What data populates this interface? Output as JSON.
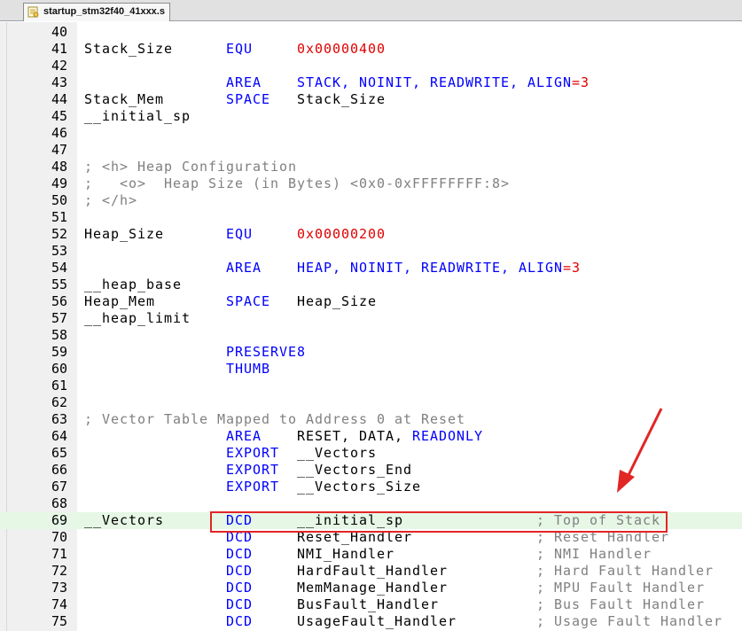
{
  "tab": {
    "filename": "startup_stm32f40_41xxx.s",
    "icon": "asm-file-icon"
  },
  "colors": {
    "keyword": "#0000ff",
    "number": "#e00000",
    "comment": "#808080",
    "highlight_row": "#e6f7e6",
    "annotation": "#e12626"
  },
  "annotation": {
    "box": "red-rectangle",
    "pointer": "red-arrow",
    "target_line": "69"
  },
  "lines": [
    {
      "n": "40",
      "tokens": []
    },
    {
      "n": "41",
      "tokens": [
        {
          "t": "Stack_Size",
          "k": "id",
          "c": 0
        },
        {
          "t": "EQU",
          "k": "kw",
          "c": 16
        },
        {
          "t": "0x00000400",
          "k": "num",
          "c": 24
        }
      ]
    },
    {
      "n": "42",
      "tokens": []
    },
    {
      "n": "43",
      "tokens": [
        {
          "t": "AREA",
          "k": "kw",
          "c": 16
        },
        {
          "t": "STACK,",
          "k": "kw",
          "c": 24
        },
        {
          "t": "NOINIT,",
          "k": "kw",
          "c": 31
        },
        {
          "t": "READWRITE,",
          "k": "kw",
          "c": 39
        },
        {
          "t": "ALIGN",
          "k": "kw",
          "c": 50
        },
        {
          "t": "=3",
          "k": "num",
          "c": 55
        }
      ]
    },
    {
      "n": "44",
      "tokens": [
        {
          "t": "Stack_Mem",
          "k": "id",
          "c": 0
        },
        {
          "t": "SPACE",
          "k": "kw",
          "c": 16
        },
        {
          "t": "Stack_Size",
          "k": "id",
          "c": 24
        }
      ]
    },
    {
      "n": "45",
      "tokens": [
        {
          "t": "__initial_sp",
          "k": "id",
          "c": 0
        }
      ]
    },
    {
      "n": "46",
      "tokens": []
    },
    {
      "n": "47",
      "tokens": []
    },
    {
      "n": "48",
      "tokens": [
        {
          "t": "; <h> Heap Configuration",
          "k": "cm",
          "c": 0
        }
      ]
    },
    {
      "n": "49",
      "tokens": [
        {
          "t": ";   <o>  Heap Size (in Bytes) <0x0-0xFFFFFFFF:8>",
          "k": "cm",
          "c": 0
        }
      ]
    },
    {
      "n": "50",
      "tokens": [
        {
          "t": "; </h>",
          "k": "cm",
          "c": 0
        }
      ]
    },
    {
      "n": "51",
      "tokens": []
    },
    {
      "n": "52",
      "tokens": [
        {
          "t": "Heap_Size",
          "k": "id",
          "c": 0
        },
        {
          "t": "EQU",
          "k": "kw",
          "c": 16
        },
        {
          "t": "0x00000200",
          "k": "num",
          "c": 24
        }
      ]
    },
    {
      "n": "53",
      "tokens": []
    },
    {
      "n": "54",
      "tokens": [
        {
          "t": "AREA",
          "k": "kw",
          "c": 16
        },
        {
          "t": "HEAP,",
          "k": "kw",
          "c": 24
        },
        {
          "t": "NOINIT,",
          "k": "kw",
          "c": 30
        },
        {
          "t": "READWRITE,",
          "k": "kw",
          "c": 38
        },
        {
          "t": "ALIGN",
          "k": "kw",
          "c": 49
        },
        {
          "t": "=3",
          "k": "num",
          "c": 54
        }
      ]
    },
    {
      "n": "55",
      "tokens": [
        {
          "t": "__heap_base",
          "k": "id",
          "c": 0
        }
      ]
    },
    {
      "n": "56",
      "tokens": [
        {
          "t": "Heap_Mem",
          "k": "id",
          "c": 0
        },
        {
          "t": "SPACE",
          "k": "kw",
          "c": 16
        },
        {
          "t": "Heap_Size",
          "k": "id",
          "c": 24
        }
      ]
    },
    {
      "n": "57",
      "tokens": [
        {
          "t": "__heap_limit",
          "k": "id",
          "c": 0
        }
      ]
    },
    {
      "n": "58",
      "tokens": []
    },
    {
      "n": "59",
      "tokens": [
        {
          "t": "PRESERVE8",
          "k": "kw",
          "c": 16
        }
      ]
    },
    {
      "n": "60",
      "tokens": [
        {
          "t": "THUMB",
          "k": "kw",
          "c": 16
        }
      ]
    },
    {
      "n": "61",
      "tokens": []
    },
    {
      "n": "62",
      "tokens": []
    },
    {
      "n": "63",
      "tokens": [
        {
          "t": "; Vector Table Mapped to Address 0 at Reset",
          "k": "cm",
          "c": 0
        }
      ]
    },
    {
      "n": "64",
      "tokens": [
        {
          "t": "AREA",
          "k": "kw",
          "c": 16
        },
        {
          "t": "RESET, DATA,",
          "k": "id",
          "c": 24
        },
        {
          "t": "READONLY",
          "k": "kw",
          "c": 37
        }
      ]
    },
    {
      "n": "65",
      "tokens": [
        {
          "t": "EXPORT",
          "k": "kw",
          "c": 16
        },
        {
          "t": "__Vectors",
          "k": "id",
          "c": 24
        }
      ]
    },
    {
      "n": "66",
      "tokens": [
        {
          "t": "EXPORT",
          "k": "kw",
          "c": 16
        },
        {
          "t": "__Vectors_End",
          "k": "id",
          "c": 24
        }
      ]
    },
    {
      "n": "67",
      "tokens": [
        {
          "t": "EXPORT",
          "k": "kw",
          "c": 16
        },
        {
          "t": "__Vectors_Size",
          "k": "id",
          "c": 24
        }
      ]
    },
    {
      "n": "68",
      "tokens": []
    },
    {
      "n": "69",
      "hl": true,
      "tokens": [
        {
          "t": "__Vectors",
          "k": "id",
          "c": 0
        },
        {
          "t": "DCD",
          "k": "kw",
          "c": 16
        },
        {
          "t": "__initial_sp",
          "k": "id",
          "c": 24
        },
        {
          "t": "; Top of Stack",
          "k": "cm",
          "c": 51
        }
      ]
    },
    {
      "n": "70",
      "tokens": [
        {
          "t": "DCD",
          "k": "kw",
          "c": 16
        },
        {
          "t": "Reset_Handler",
          "k": "id",
          "c": 24
        },
        {
          "t": "; Reset Handler",
          "k": "cm",
          "c": 51
        }
      ]
    },
    {
      "n": "71",
      "tokens": [
        {
          "t": "DCD",
          "k": "kw",
          "c": 16
        },
        {
          "t": "NMI_Handler",
          "k": "id",
          "c": 24
        },
        {
          "t": "; NMI Handler",
          "k": "cm",
          "c": 51
        }
      ]
    },
    {
      "n": "72",
      "tokens": [
        {
          "t": "DCD",
          "k": "kw",
          "c": 16
        },
        {
          "t": "HardFault_Handler",
          "k": "id",
          "c": 24
        },
        {
          "t": "; Hard Fault Handler",
          "k": "cm",
          "c": 51
        }
      ]
    },
    {
      "n": "73",
      "tokens": [
        {
          "t": "DCD",
          "k": "kw",
          "c": 16
        },
        {
          "t": "MemManage_Handler",
          "k": "id",
          "c": 24
        },
        {
          "t": "; MPU Fault Handler",
          "k": "cm",
          "c": 51
        }
      ]
    },
    {
      "n": "74",
      "tokens": [
        {
          "t": "DCD",
          "k": "kw",
          "c": 16
        },
        {
          "t": "BusFault_Handler",
          "k": "id",
          "c": 24
        },
        {
          "t": "; Bus Fault Handler",
          "k": "cm",
          "c": 51
        }
      ]
    },
    {
      "n": "75",
      "tokens": [
        {
          "t": "DCD",
          "k": "kw",
          "c": 16
        },
        {
          "t": "UsageFault_Handler",
          "k": "id",
          "c": 24
        },
        {
          "t": "; Usage Fault Handler",
          "k": "cm",
          "c": 51
        }
      ]
    }
  ]
}
